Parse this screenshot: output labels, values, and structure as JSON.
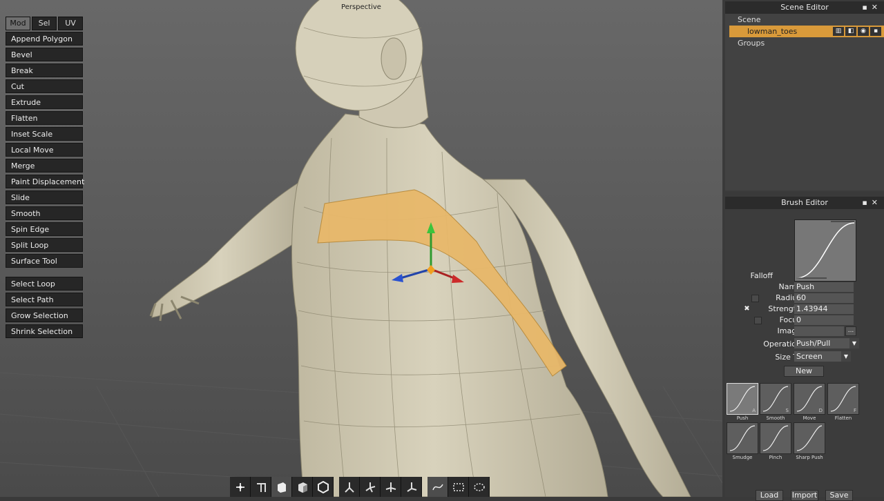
{
  "viewport": {
    "title": "Perspective"
  },
  "tools": {
    "tabs": [
      "Mod",
      "Sel",
      "UV"
    ],
    "active_tab": "Mod",
    "items": [
      "Append Polygon",
      "Bevel",
      "Break",
      "Cut",
      "Extrude",
      "Flatten",
      "Inset Scale",
      "Local Move",
      "Merge",
      "Paint Displacement",
      "Slide",
      "Smooth",
      "Spin Edge",
      "Split Loop",
      "Surface Tool"
    ],
    "selection_items": [
      "Select Loop",
      "Select Path",
      "Grow Selection",
      "Shrink Selection"
    ]
  },
  "scene_editor": {
    "title": "Scene Editor",
    "root": "Scene",
    "object": "lowman_toes",
    "groups": "Groups"
  },
  "brush_editor": {
    "title": "Brush Editor",
    "falloff_label": "Falloff",
    "name": {
      "label": "Name",
      "value": "Push"
    },
    "radius": {
      "label": "Radius",
      "value": "60"
    },
    "strength": {
      "label": "Strength",
      "value": "1.43944",
      "check": "✖"
    },
    "focus": {
      "label": "Focus",
      "value": "0"
    },
    "image": {
      "label": "Image",
      "button": "..."
    },
    "operation": {
      "label": "Operation",
      "value": "Push/Pull"
    },
    "size_to": {
      "label": "Size To",
      "value": "Screen"
    },
    "new_button": "New",
    "presets": [
      {
        "name": "Push",
        "key": "A"
      },
      {
        "name": "Smooth",
        "key": "S"
      },
      {
        "name": "Move",
        "key": "D"
      },
      {
        "name": "Flatten",
        "key": "F"
      },
      {
        "name": "Smudge",
        "key": ""
      },
      {
        "name": "Pinch",
        "key": ""
      },
      {
        "name": "Sharp Push",
        "key": ""
      }
    ],
    "buttons": [
      "Load",
      "Import",
      "Save"
    ]
  },
  "colors": {
    "selection": "#e8b86a",
    "highlight_row": "#d99a3a",
    "mesh": "#d2ccb6"
  }
}
